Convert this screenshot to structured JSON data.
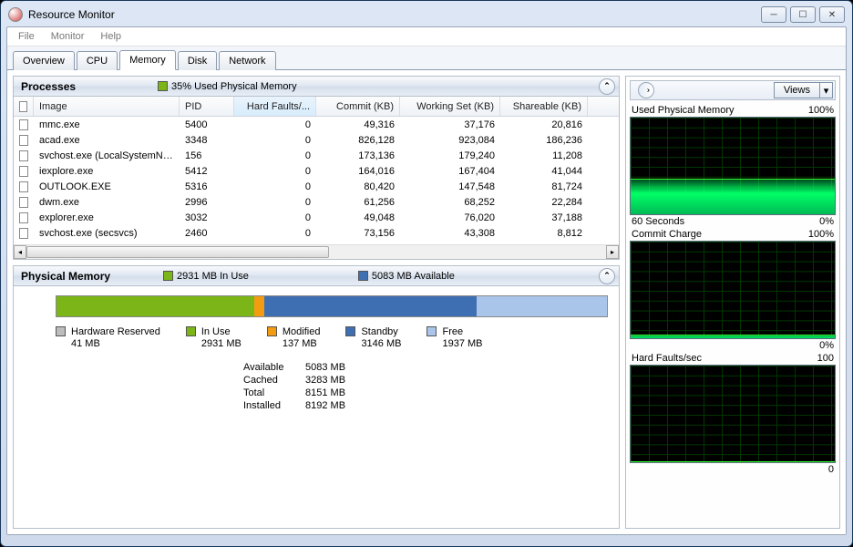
{
  "window": {
    "title": "Resource Monitor"
  },
  "menu": [
    "File",
    "Monitor",
    "Help"
  ],
  "tabs": [
    "Overview",
    "CPU",
    "Memory",
    "Disk",
    "Network"
  ],
  "activeTab": 2,
  "processesPanel": {
    "title": "Processes",
    "summary": "35% Used Physical Memory",
    "summaryColor": "#7cb518",
    "columns": [
      "Image",
      "PID",
      "Hard Faults/...",
      "Commit (KB)",
      "Working Set (KB)",
      "Shareable (KB)"
    ],
    "sortedCol": 2,
    "rows": [
      {
        "image": "mmc.exe",
        "pid": 5400,
        "hf": 0,
        "commit": "49,316",
        "ws": "37,176",
        "share": "20,816"
      },
      {
        "image": "acad.exe",
        "pid": 3348,
        "hf": 0,
        "commit": "826,128",
        "ws": "923,084",
        "share": "186,236"
      },
      {
        "image": "svchost.exe (LocalSystemNet...",
        "pid": 156,
        "hf": 0,
        "commit": "173,136",
        "ws": "179,240",
        "share": "11,208"
      },
      {
        "image": "iexplore.exe",
        "pid": 5412,
        "hf": 0,
        "commit": "164,016",
        "ws": "167,404",
        "share": "41,044"
      },
      {
        "image": "OUTLOOK.EXE",
        "pid": 5316,
        "hf": 0,
        "commit": "80,420",
        "ws": "147,548",
        "share": "81,724"
      },
      {
        "image": "dwm.exe",
        "pid": 2996,
        "hf": 0,
        "commit": "61,256",
        "ws": "68,252",
        "share": "22,284"
      },
      {
        "image": "explorer.exe",
        "pid": 3032,
        "hf": 0,
        "commit": "49,048",
        "ws": "76,020",
        "share": "37,188"
      },
      {
        "image": "svchost.exe (secsvcs)",
        "pid": 2460,
        "hf": 0,
        "commit": "73,156",
        "ws": "43,308",
        "share": "8,812"
      }
    ]
  },
  "physicalPanel": {
    "title": "Physical Memory",
    "inUseLabel": "2931 MB In Use",
    "inUseColor": "#7cb518",
    "availLabel": "5083 MB Available",
    "availColor": "#3f6fb3",
    "bar": {
      "segments": [
        {
          "color": "#7cb518",
          "pct": 36.0
        },
        {
          "color": "#f39c12",
          "pct": 1.7
        },
        {
          "color": "#3f6fb3",
          "pct": 38.6
        },
        {
          "color": "#a9c6ea",
          "pct": 23.7
        }
      ]
    },
    "legend": [
      {
        "color": "#bdbdbd",
        "name": "Hardware Reserved",
        "val": "41 MB"
      },
      {
        "color": "#7cb518",
        "name": "In Use",
        "val": "2931 MB"
      },
      {
        "color": "#f39c12",
        "name": "Modified",
        "val": "137 MB"
      },
      {
        "color": "#3f6fb3",
        "name": "Standby",
        "val": "3146 MB"
      },
      {
        "color": "#a9c6ea",
        "name": "Free",
        "val": "1937 MB"
      }
    ],
    "stats": [
      {
        "lbl": "Available",
        "val": "5083 MB"
      },
      {
        "lbl": "Cached",
        "val": "3283 MB"
      },
      {
        "lbl": "Total",
        "val": "8151 MB"
      },
      {
        "lbl": "Installed",
        "val": "8192 MB"
      }
    ]
  },
  "rightPane": {
    "viewsLabel": "Views",
    "graphs": [
      {
        "title": "Used Physical Memory",
        "right": "100%",
        "fillPct": 36,
        "footerL": "60 Seconds",
        "footerR": "0%"
      },
      {
        "title": "Commit Charge",
        "right": "100%",
        "fillPct": 3,
        "footerL": "",
        "footerR": "0%"
      },
      {
        "title": "Hard Faults/sec",
        "right": "100",
        "fillPct": 0,
        "footerL": "",
        "footerR": "0"
      }
    ]
  }
}
